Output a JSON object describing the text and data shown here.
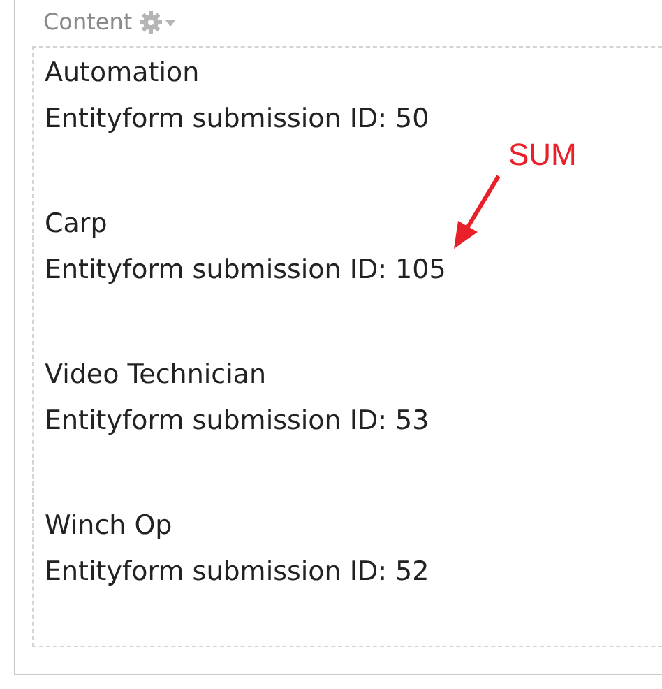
{
  "panel": {
    "title": "Content"
  },
  "items": [
    {
      "title": "Automation",
      "detail": "Entityform submission ID: 50"
    },
    {
      "title": "Carp",
      "detail": "Entityform submission ID: 105"
    },
    {
      "title": "Video Technician",
      "detail": "Entityform submission ID: 53"
    },
    {
      "title": "Winch Op",
      "detail": "Entityform submission ID: 52"
    }
  ],
  "annotation": {
    "label": "SUM"
  }
}
